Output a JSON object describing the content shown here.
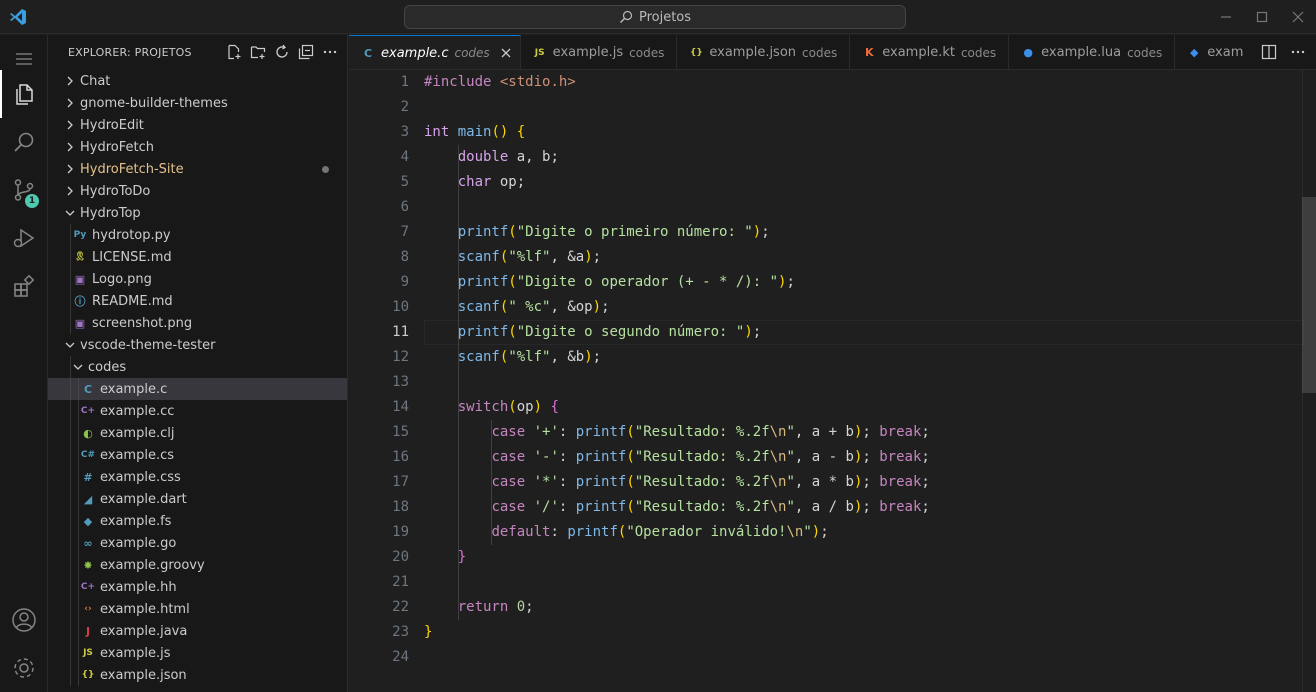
{
  "titlebar": {
    "command_center": "Projetos"
  },
  "activity_bar": {
    "source_control_badge": "1"
  },
  "explorer": {
    "header": "EXPLORER: PROJETOS",
    "items": [
      {
        "label": "Chat",
        "kind": "folder",
        "expanded": false,
        "depth": 0
      },
      {
        "label": "gnome-builder-themes",
        "kind": "folder",
        "expanded": false,
        "depth": 0
      },
      {
        "label": "HydroEdit",
        "kind": "folder",
        "expanded": false,
        "depth": 0
      },
      {
        "label": "HydroFetch",
        "kind": "folder",
        "expanded": false,
        "depth": 0
      },
      {
        "label": "HydroFetch-Site",
        "kind": "folder",
        "expanded": false,
        "depth": 0,
        "modified": true
      },
      {
        "label": "HydroToDo",
        "kind": "folder",
        "expanded": false,
        "depth": 0
      },
      {
        "label": "HydroTop",
        "kind": "folder",
        "expanded": true,
        "depth": 0
      },
      {
        "label": "hydrotop.py",
        "kind": "file",
        "icon": "python-icon",
        "depth": 1
      },
      {
        "label": "LICENSE.md",
        "kind": "file",
        "icon": "license-icon",
        "depth": 1
      },
      {
        "label": "Logo.png",
        "kind": "file",
        "icon": "image-icon",
        "depth": 1
      },
      {
        "label": "README.md",
        "kind": "file",
        "icon": "info-icon",
        "depth": 1
      },
      {
        "label": "screenshot.png",
        "kind": "file",
        "icon": "image-icon",
        "depth": 1
      },
      {
        "label": "vscode-theme-tester",
        "kind": "folder",
        "expanded": true,
        "depth": 0
      },
      {
        "label": "codes",
        "kind": "folder",
        "expanded": true,
        "depth": 1
      },
      {
        "label": "example.c",
        "kind": "file",
        "icon": "c-icon",
        "depth": 2,
        "selected": true
      },
      {
        "label": "example.cc",
        "kind": "file",
        "icon": "cpp-icon",
        "depth": 2
      },
      {
        "label": "example.clj",
        "kind": "file",
        "icon": "clojure-icon",
        "depth": 2
      },
      {
        "label": "example.cs",
        "kind": "file",
        "icon": "csharp-icon",
        "depth": 2
      },
      {
        "label": "example.css",
        "kind": "file",
        "icon": "css-icon",
        "depth": 2
      },
      {
        "label": "example.dart",
        "kind": "file",
        "icon": "dart-icon",
        "depth": 2
      },
      {
        "label": "example.fs",
        "kind": "file",
        "icon": "fsharp-icon",
        "depth": 2
      },
      {
        "label": "example.go",
        "kind": "file",
        "icon": "go-icon",
        "depth": 2
      },
      {
        "label": "example.groovy",
        "kind": "file",
        "icon": "groovy-icon",
        "depth": 2
      },
      {
        "label": "example.hh",
        "kind": "file",
        "icon": "cpp-header-icon",
        "depth": 2
      },
      {
        "label": "example.html",
        "kind": "file",
        "icon": "html-icon",
        "depth": 2
      },
      {
        "label": "example.java",
        "kind": "file",
        "icon": "java-icon",
        "depth": 2
      },
      {
        "label": "example.js",
        "kind": "file",
        "icon": "js-icon",
        "depth": 2
      },
      {
        "label": "example.json",
        "kind": "file",
        "icon": "json-icon",
        "depth": 2
      }
    ]
  },
  "tabs": [
    {
      "name": "example.c",
      "desc": "codes",
      "icon": "c-icon",
      "glyph": "C",
      "color": "#519aba",
      "active": true
    },
    {
      "name": "example.js",
      "desc": "codes",
      "icon": "js-icon",
      "glyph": "JS",
      "color": "#cbcb41"
    },
    {
      "name": "example.json",
      "desc": "codes",
      "icon": "json-icon",
      "glyph": "{}",
      "color": "#cbcb41"
    },
    {
      "name": "example.kt",
      "desc": "codes",
      "icon": "kotlin-icon",
      "glyph": "K",
      "color": "#f26a3a"
    },
    {
      "name": "example.lua",
      "desc": "codes",
      "icon": "lua-icon",
      "glyph": "●",
      "color": "#3b8eea"
    },
    {
      "name": "exam",
      "desc": "",
      "icon": "flutter-icon",
      "glyph": "◆",
      "color": "#3b8eea"
    }
  ],
  "editor": {
    "current_line": 11,
    "line_numbers": [
      "1",
      "2",
      "3",
      "4",
      "5",
      "6",
      "7",
      "8",
      "9",
      "10",
      "11",
      "12",
      "13",
      "14",
      "15",
      "16",
      "17",
      "18",
      "19",
      "20",
      "21",
      "22",
      "23",
      "24"
    ],
    "lines": [
      "#include <stdio.h>",
      "",
      "int main() {",
      "    double a, b;",
      "    char op;",
      "",
      "    printf(\"Digite o primeiro número: \");",
      "    scanf(\"%lf\", &a);",
      "    printf(\"Digite o operador (+ - * /): \");",
      "    scanf(\" %c\", &op);",
      "    printf(\"Digite o segundo número: \");",
      "    scanf(\"%lf\", &b);",
      "",
      "    switch(op) {",
      "        case '+': printf(\"Resultado: %.2f\\n\", a + b); break;",
      "        case '-': printf(\"Resultado: %.2f\\n\", a - b); break;",
      "        case '*': printf(\"Resultado: %.2f\\n\", a * b); break;",
      "        case '/': printf(\"Resultado: %.2f\\n\", a / b); break;",
      "        default: printf(\"Operador inválido!\\n\");",
      "    }",
      "",
      "    return 0;",
      "}",
      ""
    ]
  }
}
